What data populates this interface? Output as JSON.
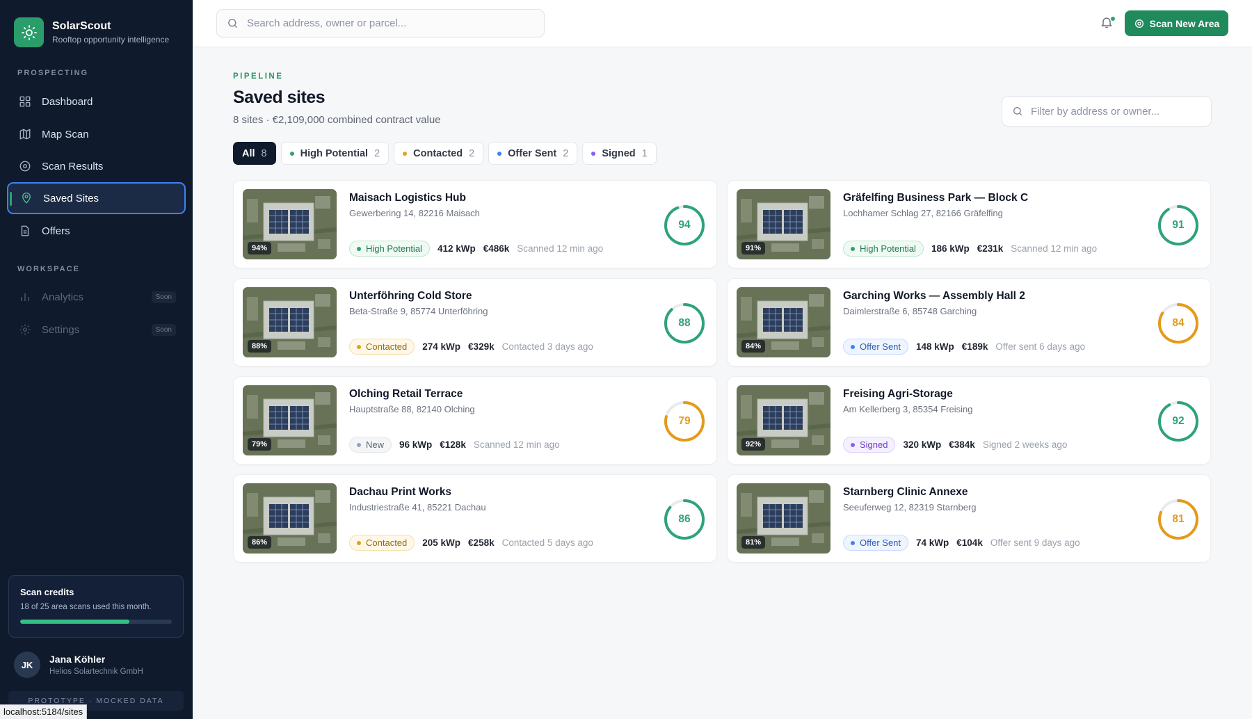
{
  "app": {
    "name": "SolarScout",
    "tagline": "Rooftop opportunity intelligence"
  },
  "sidebar": {
    "prospecting_label": "PROSPECTING",
    "workspace_label": "WORKSPACE",
    "items": [
      {
        "label": "Dashboard",
        "icon": "grid-icon"
      },
      {
        "label": "Map Scan",
        "icon": "map-icon"
      },
      {
        "label": "Scan Results",
        "icon": "target-icon"
      },
      {
        "label": "Saved Sites",
        "icon": "map-pin-icon",
        "active": true
      },
      {
        "label": "Offers",
        "icon": "document-icon"
      }
    ],
    "workspace_items": [
      {
        "label": "Analytics",
        "badge": "Soon",
        "icon": "chart-icon"
      },
      {
        "label": "Settings",
        "badge": "Soon",
        "icon": "gear-icon"
      }
    ],
    "credits": {
      "title": "Scan credits",
      "text": "18 of 25 area scans used this month.",
      "used": 18,
      "total": 25
    },
    "user": {
      "initials": "JK",
      "name": "Jana Köhler",
      "company": "Helios Solartechnik GmbH"
    },
    "prototype_label": "PROTOTYPE · MOCKED DATA"
  },
  "statusbar": {
    "url": "localhost:5184/sites"
  },
  "topbar": {
    "search_placeholder": "Search address, owner or parcel...",
    "scan_button": "Scan New Area"
  },
  "page": {
    "eyebrow": "PIPELINE",
    "title": "Saved sites",
    "subtitle": "8 sites · €2,109,000 combined contract value",
    "filter_placeholder": "Filter by address or owner..."
  },
  "chips": [
    {
      "label": "All",
      "count": "8",
      "active": true
    },
    {
      "label": "High Potential",
      "count": "2",
      "dot": "#2ea36f"
    },
    {
      "label": "Contacted",
      "count": "2",
      "dot": "#e0a21a"
    },
    {
      "label": "Offer Sent",
      "count": "2",
      "dot": "#3b82f6"
    },
    {
      "label": "Signed",
      "count": "1",
      "dot": "#8b5cf6"
    }
  ],
  "status_styles": {
    "High Potential": {
      "bg": "#eefaf3",
      "border": "#bfe6cf",
      "text": "#1f7a4d",
      "dot": "#2ea36f"
    },
    "Contacted": {
      "bg": "#fff8e8",
      "border": "#f4dfaa",
      "text": "#9a6a05",
      "dot": "#e0a21a"
    },
    "Offer Sent": {
      "bg": "#eff5ff",
      "border": "#c7dafc",
      "text": "#2b5bb8",
      "dot": "#3b82f6"
    },
    "New": {
      "bg": "#f4f5f7",
      "border": "#e3e6ea",
      "text": "#5d6573",
      "dot": "#94a3b8"
    },
    "Signed": {
      "bg": "#f5f0ff",
      "border": "#ddd0fb",
      "text": "#6b3fc9",
      "dot": "#8b5cf6"
    }
  },
  "score_colors": {
    "high": "#2ea37a",
    "medium": "#e59a1a",
    "track": "#e8eaed"
  },
  "sites": [
    {
      "name": "Maisach Logistics Hub",
      "address": "Gewerbering 14, 82216 Maisach",
      "status": "High Potential",
      "kwp": "412 kWp",
      "value": "€486k",
      "when": "Scanned 12 min ago",
      "score": 94,
      "thumb_pct": "94%"
    },
    {
      "name": "Gräfelfing Business Park — Block C",
      "address": "Lochhamer Schlag 27, 82166 Gräfelfing",
      "status": "High Potential",
      "kwp": "186 kWp",
      "value": "€231k",
      "when": "Scanned 12 min ago",
      "score": 91,
      "thumb_pct": "91%"
    },
    {
      "name": "Unterföhring Cold Store",
      "address": "Beta-Straße 9, 85774 Unterföhring",
      "status": "Contacted",
      "kwp": "274 kWp",
      "value": "€329k",
      "when": "Contacted 3 days ago",
      "score": 88,
      "thumb_pct": "88%"
    },
    {
      "name": "Garching Works — Assembly Hall 2",
      "address": "Daimlerstraße 6, 85748 Garching",
      "status": "Offer Sent",
      "kwp": "148 kWp",
      "value": "€189k",
      "when": "Offer sent 6 days ago",
      "score": 84,
      "thumb_pct": "84%"
    },
    {
      "name": "Olching Retail Terrace",
      "address": "Hauptstraße 88, 82140 Olching",
      "status": "New",
      "kwp": "96 kWp",
      "value": "€128k",
      "when": "Scanned 12 min ago",
      "score": 79,
      "thumb_pct": "79%"
    },
    {
      "name": "Freising Agri-Storage",
      "address": "Am Kellerberg 3, 85354 Freising",
      "status": "Signed",
      "kwp": "320 kWp",
      "value": "€384k",
      "when": "Signed 2 weeks ago",
      "score": 92,
      "thumb_pct": "92%"
    },
    {
      "name": "Dachau Print Works",
      "address": "Industriestraße 41, 85221 Dachau",
      "status": "Contacted",
      "kwp": "205 kWp",
      "value": "€258k",
      "when": "Contacted 5 days ago",
      "score": 86,
      "thumb_pct": "86%"
    },
    {
      "name": "Starnberg Clinic Annexe",
      "address": "Seeuferweg 12, 82319 Starnberg",
      "status": "Offer Sent",
      "kwp": "74 kWp",
      "value": "€104k",
      "when": "Offer sent 9 days ago",
      "score": 81,
      "thumb_pct": "81%"
    }
  ]
}
